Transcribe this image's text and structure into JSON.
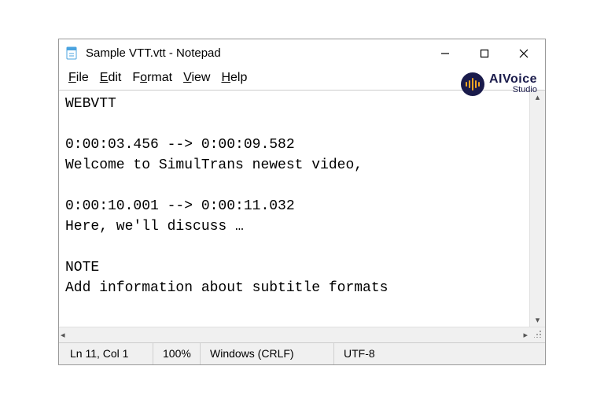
{
  "titlebar": {
    "title": "Sample VTT.vtt - Notepad"
  },
  "menu": {
    "file": "File",
    "edit": "Edit",
    "format": "Format",
    "view": "View",
    "help": "Help"
  },
  "brand": {
    "top": "AIVoice",
    "bottom": "Studio"
  },
  "editor": {
    "content": "WEBVTT\n\n0:00:03.456 --> 0:00:09.582\nWelcome to SimulTrans newest video,\n\n0:00:10.001 --> 0:00:11.032\nHere, we'll discuss …\n\nNOTE\nAdd information about subtitle formats"
  },
  "status": {
    "position": "Ln 11, Col 1",
    "zoom": "100%",
    "eol": "Windows (CRLF)",
    "encoding": "UTF-8"
  }
}
